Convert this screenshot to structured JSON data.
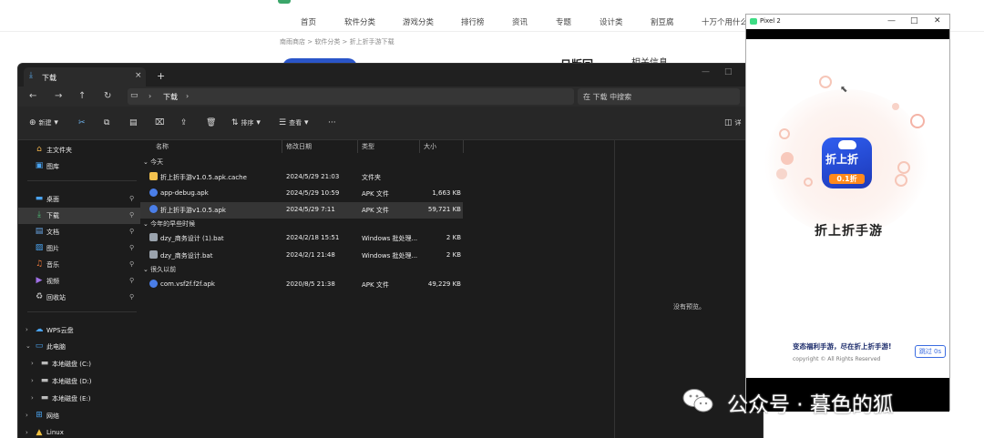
{
  "website": {
    "nav": [
      "首页",
      "软件分类",
      "游戏分类",
      "排行榜",
      "资讯",
      "专题",
      "设计类",
      "割豆腐",
      "十万个用什么"
    ],
    "breadcrumb": "南雨商店 > 软件分类 > 折上折手游下载",
    "heading": "日版回",
    "heading2": "相关信息"
  },
  "explorer": {
    "tab_title": "下载",
    "tab_close": "×",
    "tab_add": "+",
    "address": {
      "current": "下载"
    },
    "search_placeholder": "在 下载 中搜索",
    "toolbar": {
      "new": "新建",
      "sort": "排序",
      "view": "查看",
      "more": "···",
      "details": "详"
    },
    "sidebar": [
      {
        "label": "主文件夹",
        "icon": "home-icon"
      },
      {
        "label": "图库",
        "icon": "gallery-icon"
      },
      {
        "label": "桌面",
        "icon": "desktop-icon"
      },
      {
        "label": "下载",
        "icon": "download-icon"
      },
      {
        "label": "文档",
        "icon": "documents-icon"
      },
      {
        "label": "图片",
        "icon": "pictures-icon"
      },
      {
        "label": "音乐",
        "icon": "music-icon"
      },
      {
        "label": "视频",
        "icon": "videos-icon"
      },
      {
        "label": "回收站",
        "icon": "recycle-bin-icon"
      },
      {
        "label": "WPS云盘",
        "icon": "cloud-icon"
      },
      {
        "label": "此电脑",
        "icon": "this-pc-icon"
      },
      {
        "label": "本地磁盘 (C:)",
        "icon": "drive-icon"
      },
      {
        "label": "本地磁盘 (D:)",
        "icon": "drive-icon"
      },
      {
        "label": "本地磁盘 (E:)",
        "icon": "drive-icon"
      },
      {
        "label": "网络",
        "icon": "network-icon"
      },
      {
        "label": "Linux",
        "icon": "linux-icon"
      }
    ],
    "columns": {
      "name": "名称",
      "date": "修改日期",
      "type": "类型",
      "size": "大小"
    },
    "groups": [
      {
        "label": "今天",
        "files": [
          {
            "name": "折上折手游v1.0.5.apk.cache",
            "date": "2024/5/29 21:03",
            "type": "文件夹",
            "size": "",
            "icon": "folder-icon"
          },
          {
            "name": "app-debug.apk",
            "date": "2024/5/29 10:59",
            "type": "APK 文件",
            "size": "1,663 KB",
            "icon": "apk-icon"
          },
          {
            "name": "折上折手游v1.0.5.apk",
            "date": "2024/5/29 7:11",
            "type": "APK 文件",
            "size": "59,721 KB",
            "icon": "apk-icon"
          }
        ]
      },
      {
        "label": "今年的早些时候",
        "files": [
          {
            "name": "dzy_商务设计 (1).bat",
            "date": "2024/2/18 15:51",
            "type": "Windows 批处理...",
            "size": "2 KB",
            "icon": "bat-icon"
          },
          {
            "name": "dzy_商务设计.bat",
            "date": "2024/2/1 21:48",
            "type": "Windows 批处理...",
            "size": "2 KB",
            "icon": "bat-icon"
          }
        ]
      },
      {
        "label": "很久以前",
        "files": [
          {
            "name": "com.vsf2f.f2f.apk",
            "date": "2020/8/5 21:38",
            "type": "APK 文件",
            "size": "49,229 KB",
            "icon": "apk-icon"
          }
        ]
      }
    ],
    "preview_message": "没有预览。"
  },
  "emulator": {
    "title": "Pixel 2",
    "app_icon_text": "折上折",
    "app_icon_badge": "0.1折",
    "app_name": "折上折手游",
    "tagline": "变态福利手游，尽在折上折手游!",
    "skip_label": "跳过 0s",
    "copyright": "copyright © All Rights Reserved"
  },
  "watermark": "公众号 · 暮色的狐",
  "colors": {
    "accent": "#2f5ef0",
    "badge": "#ff8a1c",
    "explorer_bg": "#1c1c1c"
  }
}
